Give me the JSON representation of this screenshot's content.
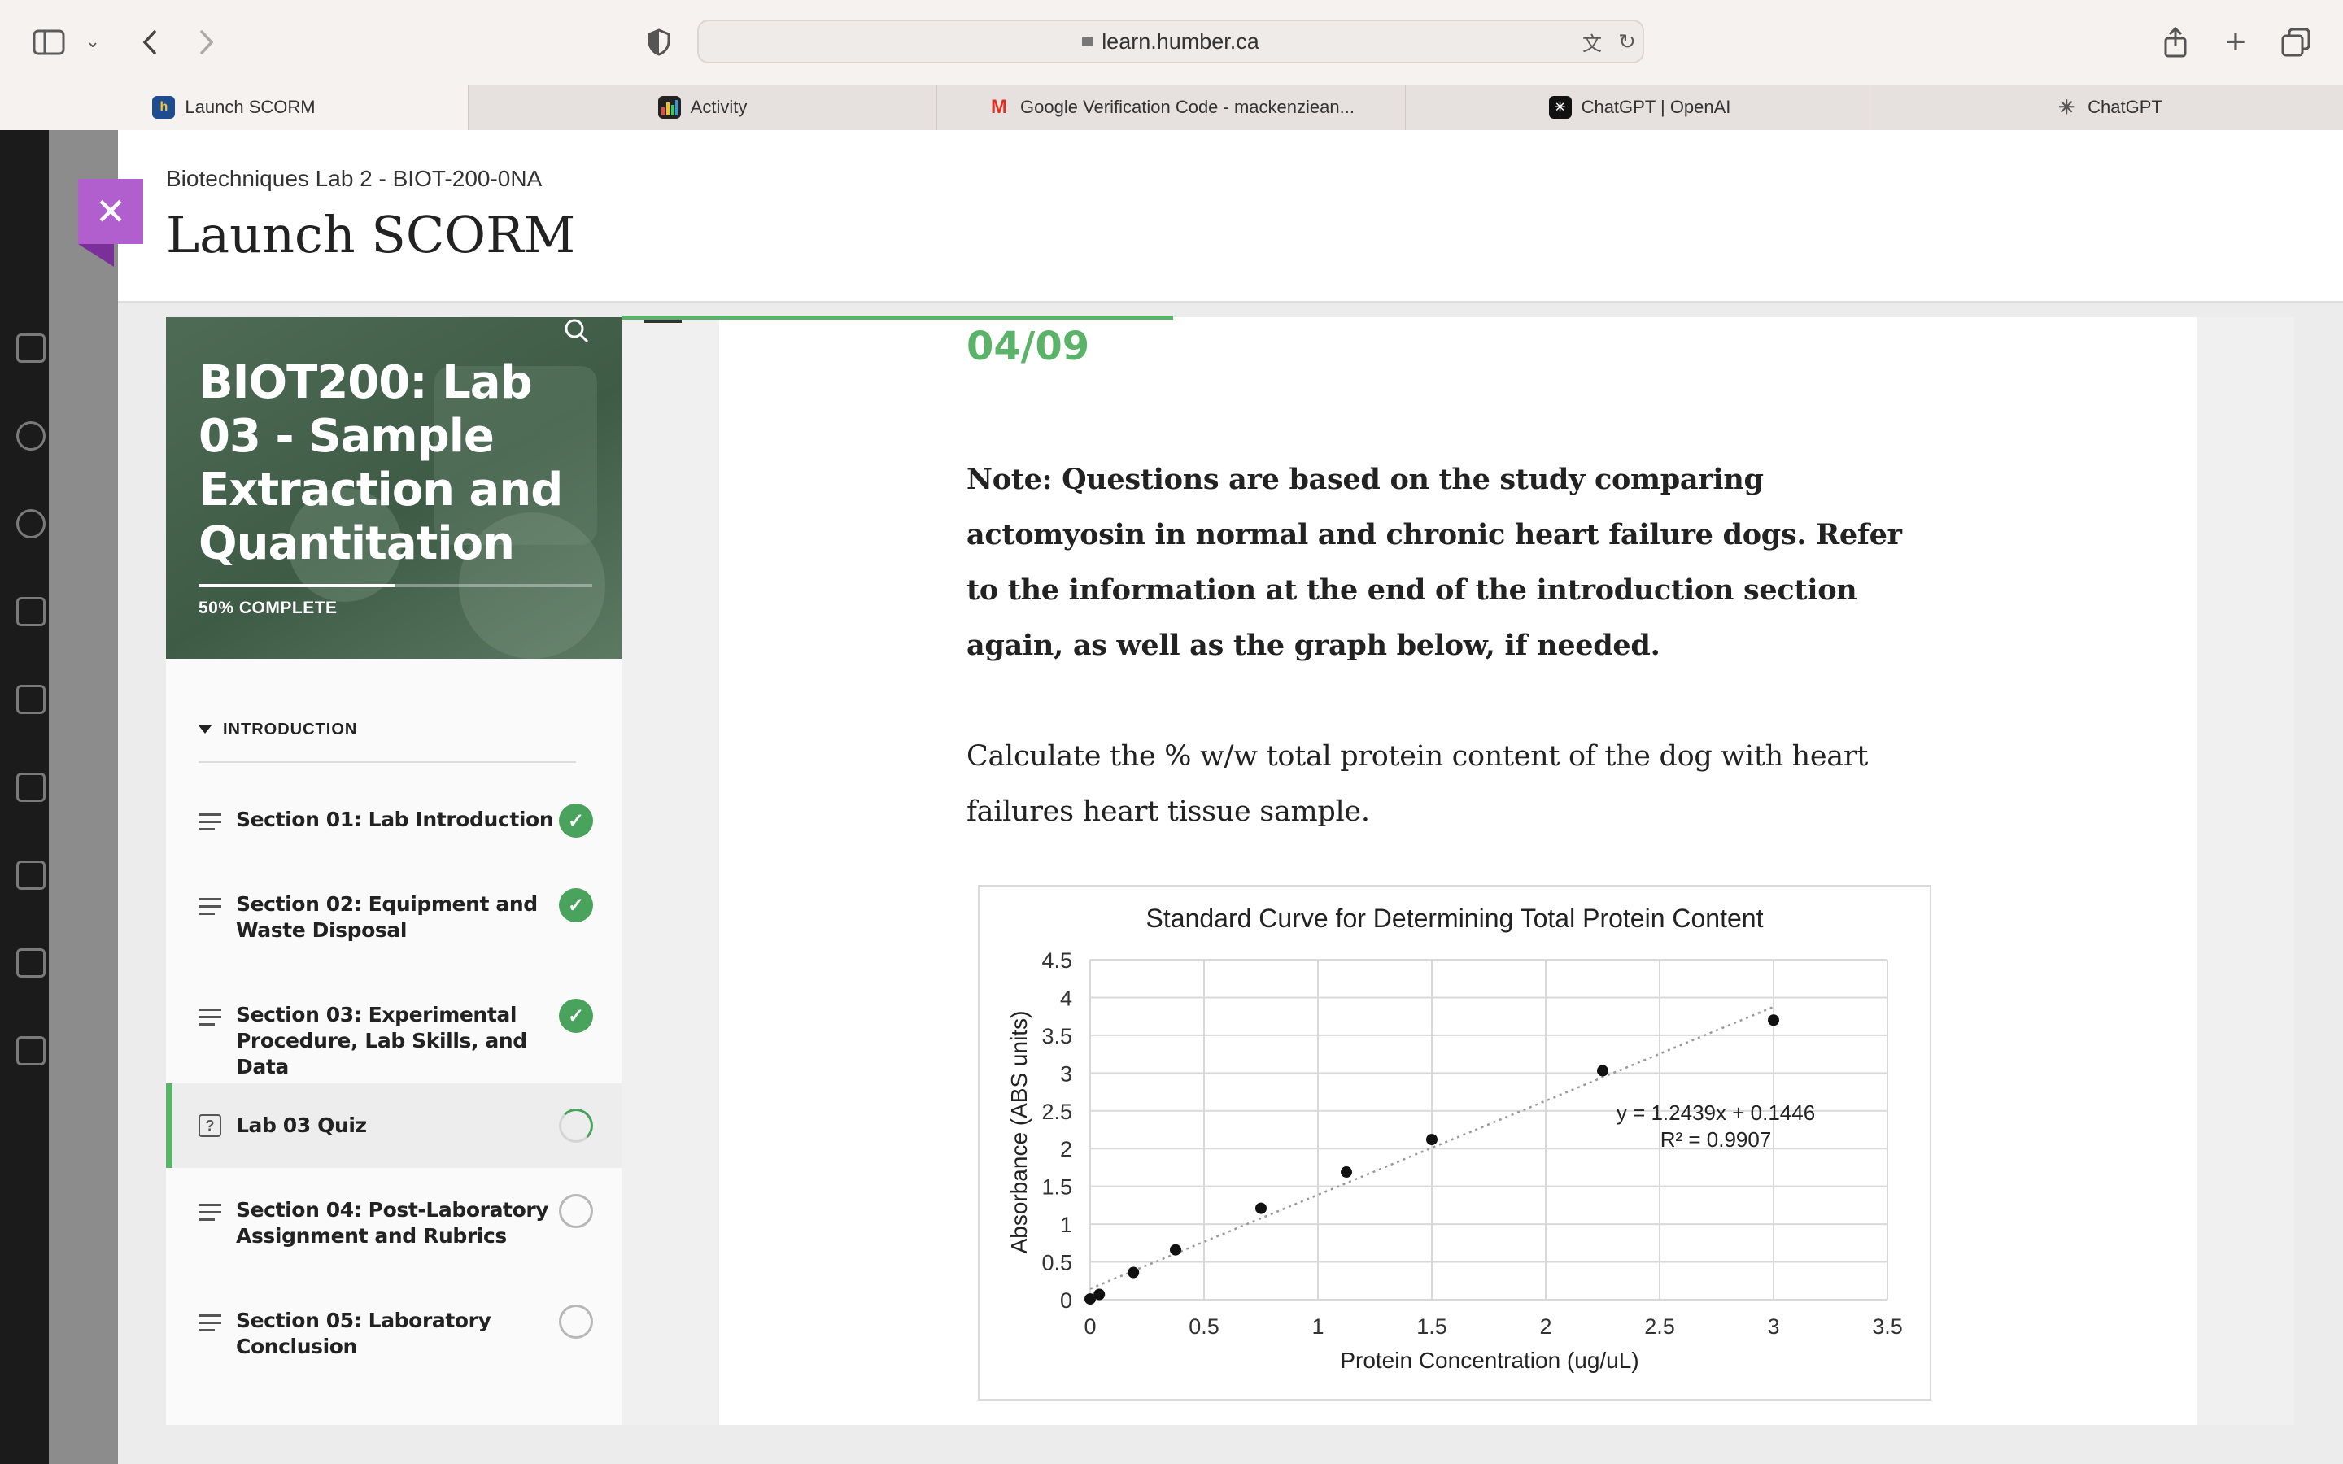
{
  "browser": {
    "url": "learn.humber.ca",
    "tabs": [
      {
        "label": "Launch SCORM",
        "active": true,
        "icon": "humber-logo-icon"
      },
      {
        "label": "Activity",
        "active": false,
        "icon": "activity-bars-icon"
      },
      {
        "label": "Google Verification Code - mackenziean...",
        "active": false,
        "icon": "gmail-icon"
      },
      {
        "label": "ChatGPT | OpenAI",
        "active": false,
        "icon": "openai-icon"
      },
      {
        "label": "ChatGPT",
        "active": false,
        "icon": "openai-icon"
      }
    ]
  },
  "modal": {
    "course_name": "Biotechniques Lab 2 - BIOT-200-0NA",
    "title": "Launch SCORM"
  },
  "sidebar": {
    "course_title": "BIOT200: Lab 03 - Sample Extraction and Quantitation",
    "progress_label": "50% COMPLETE",
    "progress_fraction": 0.5,
    "section_header": "INTRODUCTION",
    "items": [
      {
        "label": "Section 01: Lab Introduction",
        "status": "complete"
      },
      {
        "label": "Section 02: Equipment and Waste Disposal",
        "status": "complete"
      },
      {
        "label": "Section 03: Experimental Procedure, Lab Skills, and Data",
        "status": "complete"
      },
      {
        "label": "Lab 03 Quiz",
        "status": "in-progress"
      },
      {
        "label": "Section 04: Post-Laboratory Assignment and Rubrics",
        "status": "not-started"
      },
      {
        "label": "Section 05: Laboratory Conclusion",
        "status": "not-started"
      }
    ]
  },
  "content": {
    "page_counter": "04/09",
    "note": "Note: Questions are based on the study comparing actomyosin in normal and chronic heart failure dogs. Refer to the information at the end of the introduction section again, as well as the graph below, if needed.",
    "question": "Calculate the % w/w total protein content of the dog with heart failures heart tissue sample."
  },
  "colors": {
    "accent_green": "#5bb36a",
    "close_purple": "#b15fcf",
    "hero_green": "#4e6b55"
  },
  "chart_data": {
    "type": "scatter",
    "title": "Standard Curve for Determining Total Protein Content",
    "xlabel": "Protein Concentration (ug/uL)",
    "ylabel": "Absorbance (ABS units)",
    "xlim": [
      0,
      3.5
    ],
    "ylim": [
      0,
      4.5
    ],
    "x_ticks": [
      "0",
      "0.5",
      "1",
      "1.5",
      "2",
      "2.5",
      "3",
      "3.5"
    ],
    "y_ticks": [
      "0",
      "0.5",
      "1",
      "1.5",
      "2",
      "2.5",
      "3",
      "3.5",
      "4",
      "4.5"
    ],
    "grid": true,
    "series": [
      {
        "x": [
          0,
          0.04,
          0.19,
          0.375,
          0.75,
          1.125,
          1.5,
          2.25,
          3.0
        ],
        "y": [
          0.01,
          0.07,
          0.36,
          0.66,
          1.21,
          1.69,
          2.12,
          3.03,
          3.7
        ]
      }
    ],
    "trendline": {
      "style": "dotted",
      "slope": 1.2439,
      "intercept": 0.1446
    },
    "annotation_equation": "y = 1.2439x + 0.1446",
    "annotation_r2": "R² = 0.9907"
  }
}
